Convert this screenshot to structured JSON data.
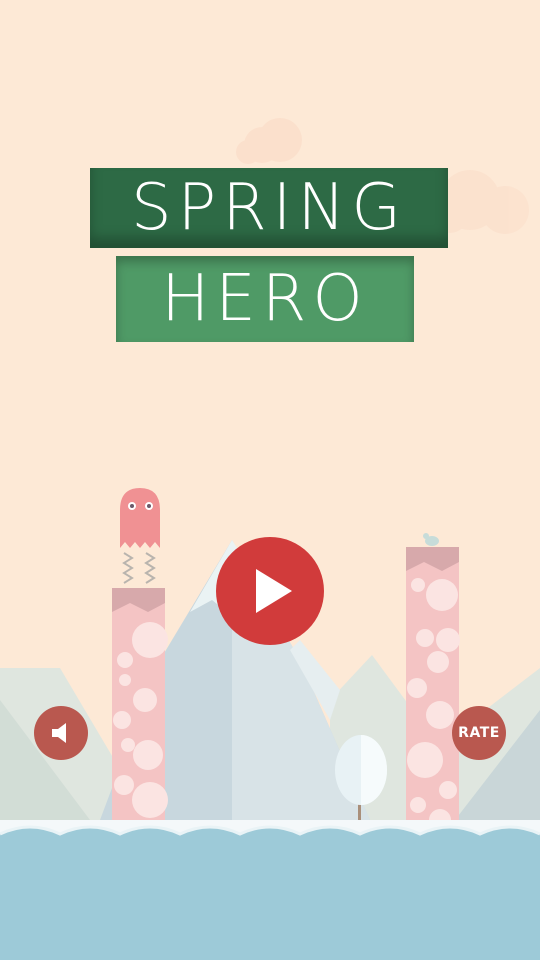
{
  "title": {
    "line1": "SPRING",
    "line2": "HERO"
  },
  "buttons": {
    "rate_label": "RATE"
  },
  "icons": {
    "play": "play-icon",
    "sound": "speaker-icon",
    "player": "ghost-character"
  },
  "colors": {
    "sky": "#fde9d6",
    "water": "#9dcad8",
    "title_dark": "#2d6a45",
    "title_light": "#4f9a66",
    "play": "#d13b3b",
    "side_buttons": "#b9584f",
    "pillar": "#f4c4c4"
  }
}
